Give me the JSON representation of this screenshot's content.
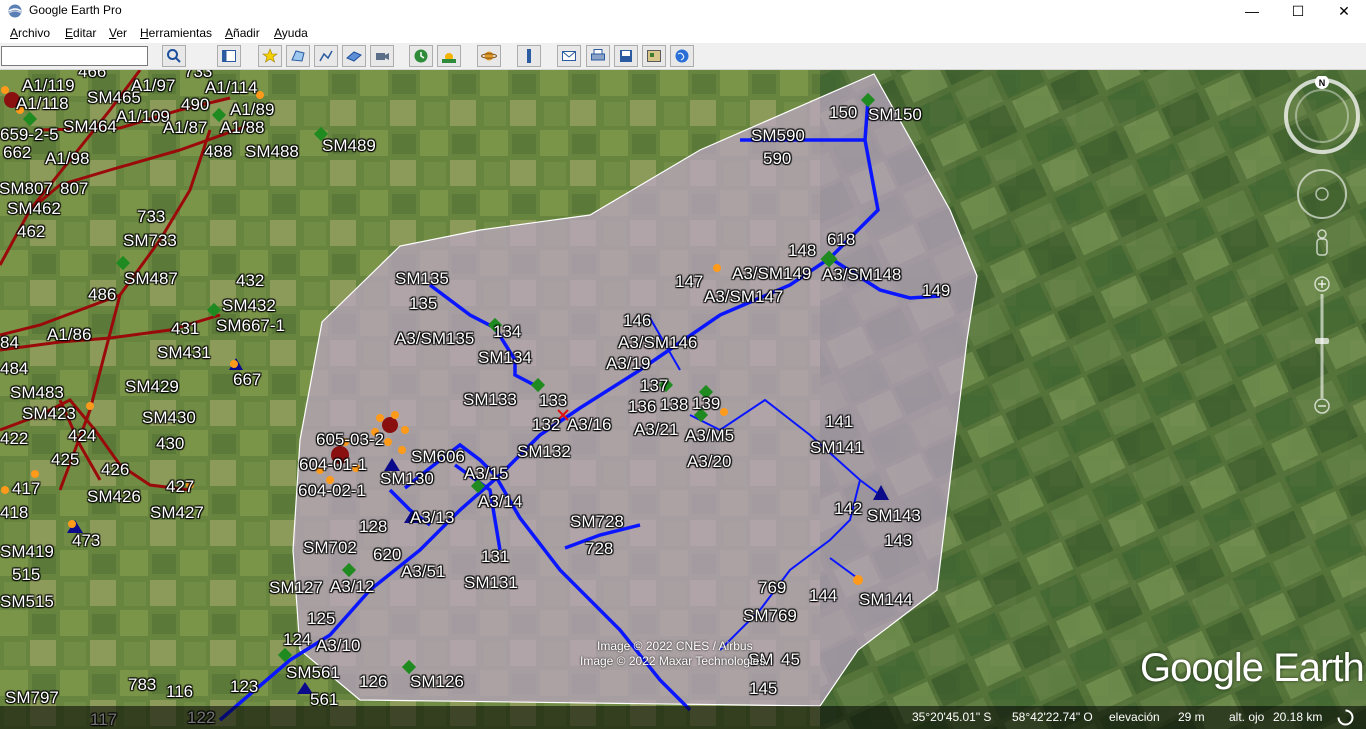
{
  "window": {
    "title": "Google Earth Pro"
  },
  "menu": {
    "archivo": {
      "u": "A",
      "rest": "rchivo"
    },
    "editar": {
      "u": "E",
      "rest": "ditar"
    },
    "ver": {
      "u": "V",
      "rest": "er"
    },
    "herramientas": {
      "u": "H",
      "rest": "erramientas"
    },
    "anadir": {
      "u": "A",
      "rest": "ñadir"
    },
    "ayuda": {
      "u": "A",
      "rest": "yuda"
    }
  },
  "search": {
    "value": "",
    "placeholder": ""
  },
  "toolbar_icons": [
    "search-icon",
    "sidebar-icon",
    "placemark-icon",
    "polygon-icon",
    "path-icon",
    "overlay-icon",
    "tour-icon",
    "history-icon",
    "sun-icon",
    "planets-icon",
    "ruler-icon",
    "email-icon",
    "print-icon",
    "save-image-icon",
    "map-view-icon",
    "earth-icon"
  ],
  "map": {
    "labels": {
      "l1": "A1/119",
      "l2": "A1/118",
      "l3": "466",
      "l4": "SM465",
      "l5": "A1/97",
      "l6": "733",
      "l7": "A1/114",
      "l8": "490",
      "l9": "A1/89",
      "l10": "A1/109",
      "l11": "SM464",
      "l12": "A1/87",
      "l13": "A1/88",
      "l14": "659-2-5",
      "l15": "662",
      "l16": "488",
      "l17": "SM488",
      "l18": "SM489",
      "l19": "A1/98",
      "l20": "SM807",
      "l21": "807",
      "l22": "SM462",
      "l23": "462",
      "l24": "733",
      "l25": "SM733",
      "l26": "SM487",
      "l27": "486",
      "l28": "432",
      "l29": "SM432",
      "l30": "SM667-1",
      "l31": "431",
      "l32": "A1/86",
      "l33": "84",
      "l34": "SM431",
      "l35": "484",
      "l36": "667",
      "l37": "SM483",
      "l38": "SM429",
      "l39": "SM423",
      "l40": "SM430",
      "l41": "422",
      "l42": "424",
      "l43": "430",
      "l44": "425",
      "l45": "426",
      "l46": "417",
      "l47": "SM426",
      "l48": "427",
      "l49": "SM427",
      "l50": "418",
      "l51": "473",
      "l52": "SM419",
      "l53": "515",
      "l54": "SM515",
      "l55": "SM797",
      "l56": "783",
      "l57": "116",
      "l58": "123",
      "l59": "122",
      "l60": "117",
      "p1": "SM590",
      "p2": "590",
      "p3": "150",
      "p4": "SM150",
      "p5": "618",
      "p6": "148",
      "p7": "147",
      "p8": "A3/SM149",
      "p9": "A3/SM148",
      "p10": "A3/SM147",
      "p11": "149",
      "p12": "SM135",
      "p13": "135",
      "p14": "134",
      "p15": "A3/SM135",
      "p16": "SM134",
      "p17": "146",
      "p18": "A3/SM146",
      "p19": "A3/19",
      "p20": "137",
      "p21": "SM133",
      "p22": "133",
      "p23": "136",
      "p24": "138",
      "p25": "139",
      "p26": "141",
      "p27": "132",
      "p28": "A3/16",
      "p29": "A3/21",
      "p30": "A3/M5",
      "p31": "SM141",
      "p32": "605-03-2",
      "p33": "SM606",
      "p34": "SM132",
      "p35": "A3/20",
      "p36": "604-01-1",
      "p37": "A3/15",
      "p38": "SM130",
      "p39": "604-02-1",
      "p40": "A3/14",
      "p41": "142",
      "p42": "SM143",
      "p43": "A3/13",
      "p44": "SM728",
      "p45": "128",
      "p46": "143",
      "p47": "728",
      "p48": "SM702",
      "p49": "620",
      "p50": "131",
      "p51": "A3/51",
      "p52": "SM131",
      "p53": "769",
      "p54": "SM127",
      "p55": "A3/12",
      "p56": "144",
      "p57": "SM144",
      "p58": "125",
      "p59": "SM769",
      "p60": "124",
      "p61": "A3/10",
      "p62": "SM561",
      "p63": "45",
      "p64": "SM",
      "p65": "126",
      "p66": "SM126",
      "p67": "561",
      "p68": "145"
    },
    "credits": {
      "line1": "Image © 2022 CNES / Airbus",
      "line2": "Image © 2022 Maxar Technologies"
    },
    "logo": "Google Earth"
  },
  "status": {
    "lat": "35°20'45.01\" S",
    "lon": "58°42'22.74\" O",
    "elev_label": "elevación",
    "elev_value": "29 m",
    "eye_label": "alt. ojo",
    "eye_value": "20.18 km"
  },
  "colors": {
    "network_blue": "#0a16ff",
    "network_red": "#9a0a0a",
    "polygon_fill": "#bfa8c6",
    "marker_green": "#1f8a1f",
    "marker_orange": "#ff9a1a"
  }
}
